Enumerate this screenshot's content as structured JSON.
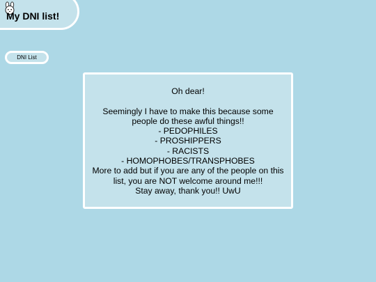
{
  "header": {
    "title": "My DNI list!"
  },
  "nav": {
    "dni_list_label": "DNI List"
  },
  "card": {
    "greeting": "Oh dear!",
    "lines": [
      "Seemingly I have to make this because some people do these awful things!!",
      "- PEDOPHILES",
      "- PROSHIPPERS",
      "- RACISTS",
      "- HOMOPHOBES/TRANSPHOBES",
      "More to add but if you are any of the people on this list, you are NOT welcome around me!!!",
      "Stay away, thank you!! UwU"
    ]
  },
  "colors": {
    "background": "#add8e6",
    "panel": "#c4e2eb",
    "border": "#ffffff"
  }
}
